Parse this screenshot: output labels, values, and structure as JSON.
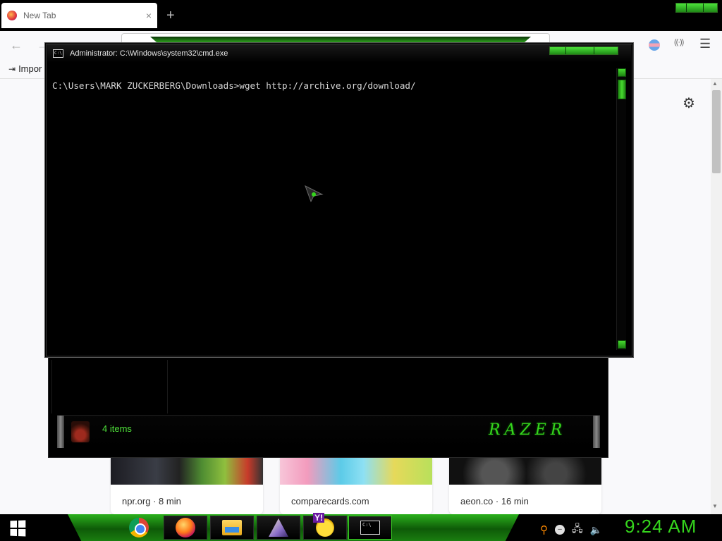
{
  "browser": {
    "tab_title": "New Tab",
    "tab_close": "×",
    "new_tab": "+",
    "bookmark_import": "Impor",
    "stories": [
      {
        "source": "npr.org · 8 min"
      },
      {
        "source": "comparecards.com"
      },
      {
        "source": "aeon.co · 16 min"
      }
    ]
  },
  "cmd": {
    "title": "Administrator: C:\\Windows\\system32\\cmd.exe",
    "prompt_line": "C:\\Users\\MARK ZUCKERBERG\\Downloads>wget http://archive.org/download/",
    "icon_text": "C:\\"
  },
  "explorer": {
    "status_items": "4 items",
    "brand": "RAZER"
  },
  "taskbar": {
    "clock": "9:24 AM",
    "apps": [
      "chrome-icon",
      "firefox-icon",
      "file-explorer-icon",
      "app-icon",
      "yahoo-messenger-icon",
      "cmd-icon"
    ]
  },
  "colors": {
    "accent_green": "#35d61d",
    "terminal_text": "#d8d8d8",
    "tray_search": "#ff8a00"
  }
}
